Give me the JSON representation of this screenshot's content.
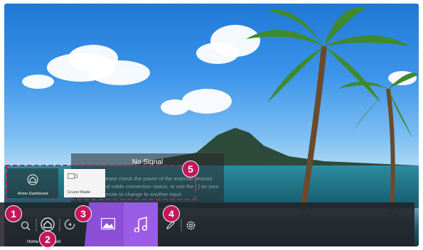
{
  "overlay": {
    "title": "No Signal",
    "message": "Please check the power of the external devices and cable connection status, or use the [ ] on your remote to change to another input."
  },
  "recent": {
    "items": [
      {
        "label": "Home Dashboard",
        "icon": "home-dashboard-icon"
      },
      {
        "label": "Cruzer Blade",
        "icon": "usb-drive-icon"
      }
    ]
  },
  "launcher": {
    "home_label": "Home Dashboard",
    "icons": [
      "search-icon",
      "home-icon",
      "input-switch-icon",
      "gallery-icon",
      "music-icon",
      "edit-icon",
      "settings-icon"
    ]
  },
  "callouts": [
    "1",
    "2",
    "3",
    "4",
    "5"
  ],
  "colors": {
    "callout": "#c2185b",
    "gallery_tile": "#8c4fd6",
    "music_tile": "#9b5de5"
  }
}
